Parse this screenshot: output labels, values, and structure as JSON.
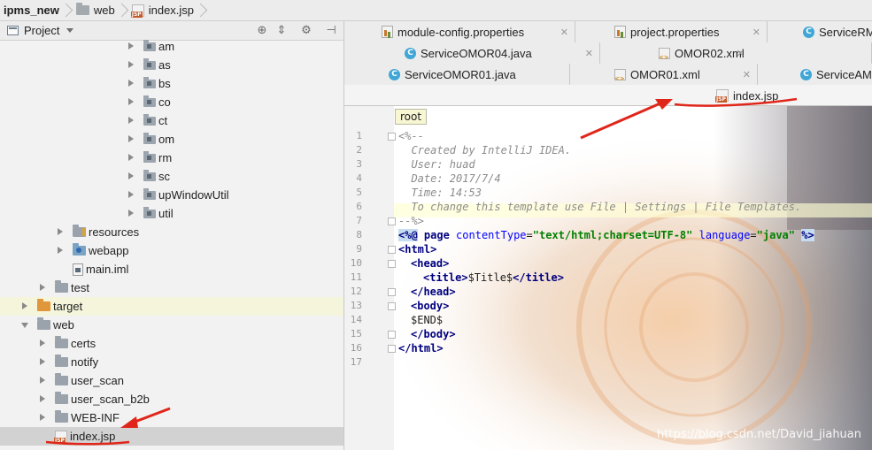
{
  "breadcrumb": {
    "project": "ipms_new",
    "folder": "web",
    "file": "index.jsp"
  },
  "project_panel": {
    "title": "Project",
    "toolbar_icons": [
      "crosshair-icon",
      "collapse-icon",
      "gear-icon",
      "hide-icon"
    ]
  },
  "tree": {
    "packages": [
      "am",
      "as",
      "bs",
      "co",
      "ct",
      "om",
      "rm",
      "sc",
      "upWindowUtil",
      "util"
    ],
    "resources": "resources",
    "webapp": "webapp",
    "main_iml": "main.iml",
    "test": "test",
    "target": "target",
    "web": "web",
    "web_children": [
      "certs",
      "notify",
      "user_scan",
      "user_scan_b2b",
      "WEB-INF"
    ],
    "index_jsp": "index.jsp"
  },
  "tabs": {
    "row1": [
      "module-config.properties",
      "project.properties",
      "ServiceRM"
    ],
    "row2": [
      "ServiceOMOR04.java",
      "OMOR02.xml"
    ],
    "row3": [
      "ServiceOMOR01.java",
      "OMOR01.xml",
      "ServiceAM"
    ],
    "active": "index.jsp"
  },
  "editor": {
    "tooltip": "root",
    "line_numbers": [
      "1",
      "2",
      "3",
      "4",
      "5",
      "6",
      "7",
      "8",
      "9",
      "10",
      "11",
      "12",
      "13",
      "14",
      "15",
      "16",
      "17"
    ],
    "comment": {
      "open": "<%--",
      "l2": "  Created by IntelliJ IDEA.",
      "l3": "  User: huad",
      "l4": "  Date: 2017/7/4",
      "l5": "  Time: 14:53",
      "l6": "  To change this template use File | Settings | File Templates.",
      "close": "--%>"
    },
    "directive": {
      "open": "<%@",
      "page": " page ",
      "ct_attr": "contentType",
      "eq": "=",
      "ct_val": "\"text/html;charset=UTF-8\"",
      "lang_attr": " language",
      "lang_val": "\"java\"",
      "close": "%>"
    },
    "html_open": "<html>",
    "head_open": "<head>",
    "title_open": "<title>",
    "title_text": "$Title$",
    "title_close": "</title>",
    "head_close": "</head>",
    "body_open": "<body>",
    "end_var": "$END$",
    "body_close": "</body>",
    "html_close": "</html>"
  },
  "watermark": "https://blog.csdn.net/David_jiahuan",
  "colors": {
    "annotation_red": "#e0261a",
    "selection": "#d2d2d2",
    "java_class": "#3fa6d6"
  }
}
